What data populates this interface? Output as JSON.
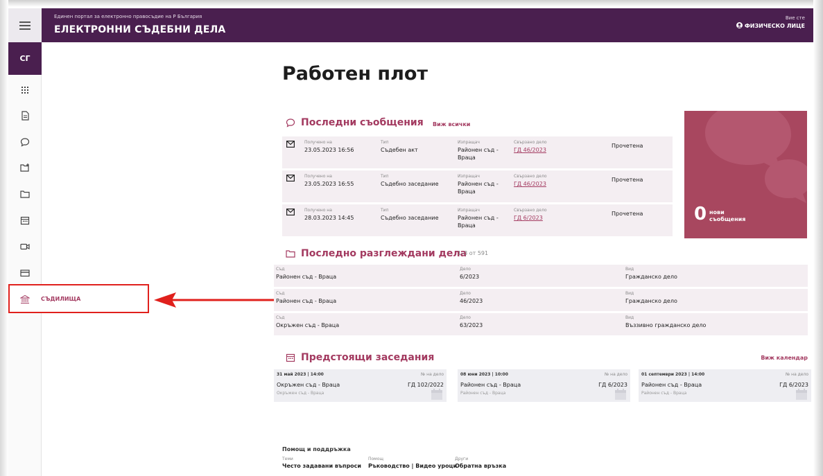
{
  "header": {
    "portal": "Единен портал за електронно правосъдие на Р България",
    "title": "ЕЛЕКТРОННИ СЪДЕБНИ ДЕЛА",
    "user_label": "Вие сте",
    "user_role": "ФИЗИЧЕСКО ЛИЦЕ"
  },
  "sidebar": {
    "avatar": "СГ",
    "courts_label": "СЪДИЛИЩА"
  },
  "page": {
    "title": "Работен плот"
  },
  "messages": {
    "title": "Последни съобщения",
    "view_all": "Виж всички",
    "labels": {
      "received": "Получено на",
      "type": "Тип",
      "sender": "Изпращач",
      "case": "Свързано дело"
    },
    "rows": [
      {
        "received": "23.05.2023 16:56",
        "type": "Съдебен акт",
        "sender": "Районен съд - Враца",
        "case": "ГД 46/2023",
        "status": "Прочетена"
      },
      {
        "received": "23.05.2023 16:55",
        "type": "Съдебно заседание",
        "sender": "Районен съд - Враца",
        "case": "ГД 46/2023",
        "status": "Прочетена"
      },
      {
        "received": "28.03.2023 14:45",
        "type": "Съдебно заседание",
        "sender": "Районен съд - Враца",
        "case": "ГД 6/2023",
        "status": "Прочетена"
      }
    ],
    "new_count": "0",
    "new_label_1": "нови",
    "new_label_2": "съобщения"
  },
  "cases": {
    "title": "Последно разглеждани дела",
    "range": "1–3 от 591",
    "labels": {
      "court": "Съд",
      "case": "Дело",
      "kind": "Вид"
    },
    "rows": [
      {
        "court": "Районен съд - Враца",
        "case": "6/2023",
        "kind": "Гражданско дело"
      },
      {
        "court": "Районен съд - Враца",
        "case": "46/2023",
        "kind": "Гражданско дело"
      },
      {
        "court": "Окръжен съд - Враца",
        "case": "63/2023",
        "kind": "Въззивно гражданско дело"
      }
    ]
  },
  "hearings": {
    "title": "Предстоящи заседания",
    "calendar_link": "Виж календар",
    "case_no_label": "№ на дело",
    "items": [
      {
        "date": "31 май 2023 | 14:00",
        "court": "Окръжен съд - Враца",
        "case": "ГД 102/2022",
        "sub": "Окръжен съд - Враца"
      },
      {
        "date": "08 юни 2023 | 10:00",
        "court": "Районен съд - Враца",
        "case": "ГД 6/2023",
        "sub": "Районен съд - Враца"
      },
      {
        "date": "01 септември 2023 | 14:00",
        "court": "Районен съд - Враца",
        "case": "ГД 6/2023",
        "sub": "Районен съд - Враца"
      }
    ]
  },
  "footer": {
    "title": "Помощ и поддръжка",
    "cols": [
      {
        "label": "Теми",
        "value": "Често задавани въпроси"
      },
      {
        "label": "Помощ",
        "value": "Ръководство | Видео уроци"
      },
      {
        "label": "Други",
        "value": "Обратна връзка"
      }
    ]
  }
}
